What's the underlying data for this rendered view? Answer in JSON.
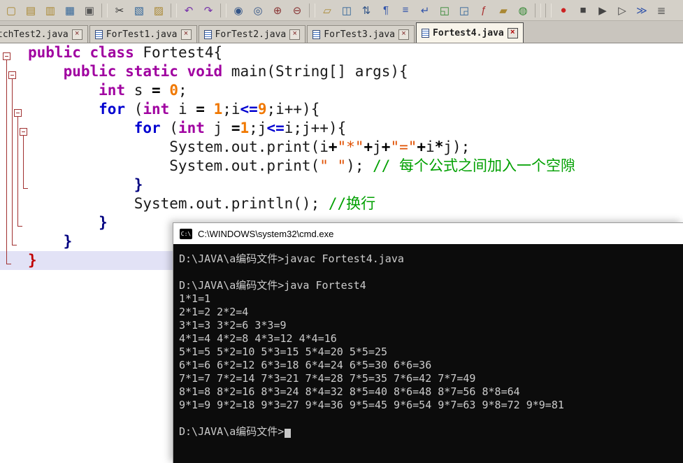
{
  "toolbar": {
    "items": [
      {
        "name": "new-file-icon",
        "glyph": "▢",
        "color": "#aa8833"
      },
      {
        "name": "open-file-icon",
        "glyph": "▤",
        "color": "#aa8833"
      },
      {
        "name": "favorites-icon",
        "glyph": "▥",
        "color": "#aa8833"
      },
      {
        "name": "save-file-icon",
        "glyph": "▦",
        "color": "#336699"
      },
      {
        "name": "print-icon",
        "glyph": "▣",
        "color": "#555555"
      },
      {
        "sep": true
      },
      {
        "name": "cut-icon",
        "glyph": "✂",
        "color": "#333333"
      },
      {
        "name": "copy-icon",
        "glyph": "▧",
        "color": "#336699"
      },
      {
        "name": "paste-icon",
        "glyph": "▨",
        "color": "#aa8833"
      },
      {
        "sep": true
      },
      {
        "name": "undo-icon",
        "glyph": "↶",
        "color": "#7733aa"
      },
      {
        "name": "redo-icon",
        "glyph": "↷",
        "color": "#7733aa"
      },
      {
        "sep": true
      },
      {
        "name": "find-icon",
        "glyph": "◉",
        "color": "#335588"
      },
      {
        "name": "find-in-files-icon",
        "glyph": "◎",
        "color": "#335588"
      },
      {
        "name": "zoom-in-icon",
        "glyph": "⊕",
        "color": "#883333"
      },
      {
        "name": "zoom-out-icon",
        "glyph": "⊖",
        "color": "#883333"
      },
      {
        "sep": true
      },
      {
        "name": "new-window-icon",
        "glyph": "▱",
        "color": "#aa8833"
      },
      {
        "name": "split-window-icon",
        "glyph": "◫",
        "color": "#336699"
      },
      {
        "name": "sort-icon",
        "glyph": "⇅",
        "color": "#335588"
      },
      {
        "name": "paragraph-marks-icon",
        "glyph": "¶",
        "color": "#3355aa"
      },
      {
        "name": "line-numbers-icon",
        "glyph": "≡",
        "color": "#3355aa"
      },
      {
        "name": "word-wrap-icon",
        "glyph": "↵",
        "color": "#3355aa"
      },
      {
        "name": "html-view-icon",
        "glyph": "◱",
        "color": "#338833"
      },
      {
        "name": "script-icon",
        "glyph": "◲",
        "color": "#336699"
      },
      {
        "name": "function-icon",
        "glyph": "ƒ",
        "color": "#aa3333"
      },
      {
        "name": "folder-icon",
        "glyph": "▰",
        "color": "#aa8833"
      },
      {
        "name": "preview-icon",
        "glyph": "◍",
        "color": "#338833"
      },
      {
        "sep": true
      },
      {
        "sep": true
      },
      {
        "name": "record-macro-icon",
        "glyph": "●",
        "color": "#cc2222"
      },
      {
        "name": "stop-macro-icon",
        "glyph": "■",
        "color": "#444444"
      },
      {
        "name": "play-macro-icon",
        "glyph": "▶",
        "color": "#444444"
      },
      {
        "name": "play-to-cursor-icon",
        "glyph": "▷",
        "color": "#444444"
      },
      {
        "name": "fast-play-icon",
        "glyph": "≫",
        "color": "#3355aa"
      },
      {
        "name": "macro-list-icon",
        "glyph": "≣",
        "color": "#444444"
      }
    ]
  },
  "tabbar": {
    "close_glyph": "×",
    "tabs": [
      {
        "label": "tchTest2.java",
        "active": false
      },
      {
        "label": "ForTest1.java",
        "active": false
      },
      {
        "label": "ForTest2.java",
        "active": false
      },
      {
        "label": "ForTest3.java",
        "active": false
      },
      {
        "label": "Fortest4.java",
        "active": true
      }
    ]
  },
  "editor": {
    "lines": [
      {
        "tokens": [
          {
            "c": "kw",
            "t": "public class "
          },
          {
            "c": "pl",
            "t": "Fortest4{"
          }
        ]
      },
      {
        "tokens": [
          {
            "c": "pl",
            "t": "    "
          },
          {
            "c": "kw",
            "t": "public static void "
          },
          {
            "c": "pl",
            "t": "main(String[] args){"
          }
        ]
      },
      {
        "tokens": [
          {
            "c": "pl",
            "t": "        "
          },
          {
            "c": "kw",
            "t": "int"
          },
          {
            "c": "pl",
            "t": " s "
          },
          {
            "c": "op",
            "t": "="
          },
          {
            "c": "pl",
            "t": " "
          },
          {
            "c": "num",
            "t": "0"
          },
          {
            "c": "pl",
            "t": ";"
          }
        ]
      },
      {
        "tokens": [
          {
            "c": "pl",
            "t": "        "
          },
          {
            "c": "kwf",
            "t": "for"
          },
          {
            "c": "pl",
            "t": " ("
          },
          {
            "c": "kw",
            "t": "int"
          },
          {
            "c": "pl",
            "t": " i "
          },
          {
            "c": "op",
            "t": "="
          },
          {
            "c": "pl",
            "t": " "
          },
          {
            "c": "num",
            "t": "1"
          },
          {
            "c": "pl",
            "t": ";i"
          },
          {
            "c": "opb",
            "t": "<="
          },
          {
            "c": "num",
            "t": "9"
          },
          {
            "c": "pl",
            "t": ";i++){"
          }
        ]
      },
      {
        "tokens": [
          {
            "c": "pl",
            "t": "            "
          },
          {
            "c": "kwf",
            "t": "for"
          },
          {
            "c": "pl",
            "t": " ("
          },
          {
            "c": "kw",
            "t": "int"
          },
          {
            "c": "pl",
            "t": " j "
          },
          {
            "c": "op",
            "t": "="
          },
          {
            "c": "num",
            "t": "1"
          },
          {
            "c": "pl",
            "t": ";j"
          },
          {
            "c": "opb",
            "t": "<="
          },
          {
            "c": "pl",
            "t": "i;j++){"
          }
        ]
      },
      {
        "tokens": [
          {
            "c": "pl",
            "t": "                System.out.print(i"
          },
          {
            "c": "op",
            "t": "+"
          },
          {
            "c": "str",
            "t": "\"*\""
          },
          {
            "c": "op",
            "t": "+"
          },
          {
            "c": "pl",
            "t": "j"
          },
          {
            "c": "op",
            "t": "+"
          },
          {
            "c": "str",
            "t": "\"=\""
          },
          {
            "c": "op",
            "t": "+"
          },
          {
            "c": "pl",
            "t": "i"
          },
          {
            "c": "op",
            "t": "*"
          },
          {
            "c": "pl",
            "t": "j);"
          }
        ]
      },
      {
        "tokens": [
          {
            "c": "pl",
            "t": "                System.out.print("
          },
          {
            "c": "str",
            "t": "\" \""
          },
          {
            "c": "pl",
            "t": "); "
          },
          {
            "c": "cm",
            "t": "// 每个公式之间加入一个空隙"
          }
        ]
      },
      {
        "tokens": [
          {
            "c": "pl",
            "t": "            "
          },
          {
            "c": "br",
            "t": "}"
          }
        ]
      },
      {
        "tokens": [
          {
            "c": "pl",
            "t": "            System.out.println(); "
          },
          {
            "c": "cm",
            "t": "//换行"
          }
        ]
      },
      {
        "tokens": [
          {
            "c": "pl",
            "t": "        "
          },
          {
            "c": "br",
            "t": "}"
          }
        ]
      },
      {
        "tokens": [
          {
            "c": "pl",
            "t": "    "
          },
          {
            "c": "br",
            "t": "}"
          }
        ]
      },
      {
        "highlight": true,
        "tokens": [
          {
            "c": "brr",
            "t": "}"
          }
        ]
      }
    ],
    "folds": [
      {
        "start": 1,
        "end": 12,
        "depth": 0
      },
      {
        "start": 2,
        "end": 11,
        "depth": 1
      },
      {
        "start": 4,
        "end": 10,
        "depth": 2
      },
      {
        "start": 5,
        "end": 8,
        "depth": 3
      }
    ]
  },
  "console": {
    "title": "C:\\WINDOWS\\system32\\cmd.exe",
    "icon_text": "C:\\",
    "lines": [
      "D:\\JAVA\\a编码文件>javac Fortest4.java",
      "",
      "D:\\JAVA\\a编码文件>java Fortest4",
      "1*1=1",
      "2*1=2 2*2=4",
      "3*1=3 3*2=6 3*3=9",
      "4*1=4 4*2=8 4*3=12 4*4=16",
      "5*1=5 5*2=10 5*3=15 5*4=20 5*5=25",
      "6*1=6 6*2=12 6*3=18 6*4=24 6*5=30 6*6=36",
      "7*1=7 7*2=14 7*3=21 7*4=28 7*5=35 7*6=42 7*7=49",
      "8*1=8 8*2=16 8*3=24 8*4=32 8*5=40 8*6=48 8*7=56 8*8=64",
      "9*1=9 9*2=18 9*3=27 9*4=36 9*5=45 9*6=54 9*7=63 9*8=72 9*9=81",
      "",
      "D:\\JAVA\\a编码文件>"
    ]
  }
}
